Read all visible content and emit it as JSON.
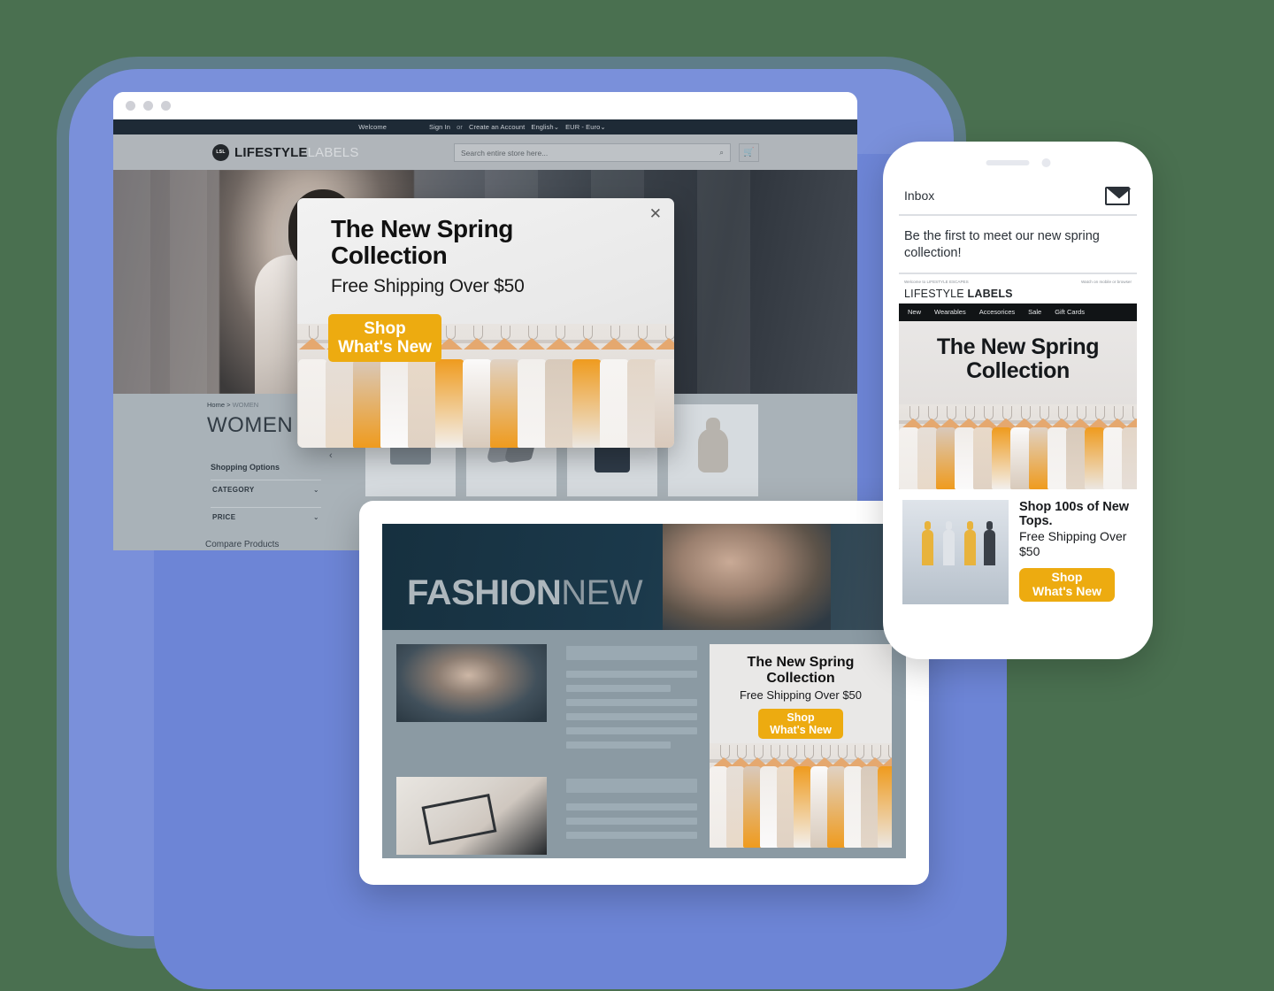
{
  "theme": {
    "background": "#4a7050",
    "frame_blue": "#6d85d6",
    "accent_yellow": "#edab10",
    "dark_navy": "#1e2a36"
  },
  "browser": {
    "window_dots": 3,
    "topbar": {
      "welcome": "Welcome",
      "sign_in": "Sign In",
      "or": "or",
      "create_account": "Create an Account",
      "language": "English",
      "currency": "EUR - Euro",
      "chevron": "⌄"
    },
    "header": {
      "logo_badge": "LSL",
      "logo_bold": "LIFESTYLE",
      "logo_light": "LABELS",
      "search_placeholder": "Search entire store here...",
      "search_icon": "⌕",
      "cart_icon": "🛒"
    },
    "category": {
      "breadcrumb_home": "Home",
      "breadcrumb_sep": ">",
      "breadcrumb_current": "WOMEN",
      "title": "WOMEN",
      "shopping_options": "Shopping Options",
      "filters": [
        {
          "label": "CATEGORY",
          "chevron": "⌄"
        },
        {
          "label": "PRICE",
          "chevron": "⌄"
        }
      ],
      "compare": "Compare Products",
      "carousel_prev": "‹",
      "tiles": [
        "handbag-thumbnail",
        "heels-thumbnail",
        "dress-thumbnail",
        "necklace-bust-thumbnail"
      ]
    },
    "popup": {
      "close": "✕",
      "title": "The New Spring Collection",
      "subtitle": "Free Shipping Over $50",
      "cta_line1": "Shop",
      "cta_line2": "What's New"
    }
  },
  "phone": {
    "inbox_label": "Inbox",
    "envelope_icon": "envelope-icon",
    "preheader": "Be the first to meet our new spring collection!",
    "email": {
      "preheader_left": "Welcome to LIFESTYLE ESCAPES",
      "preheader_right": "Watch on mobile or browser",
      "logo_light": "LIFESTYLE",
      "logo_bold": "LABELS",
      "nav": [
        "New",
        "Wearables",
        "Accesorices",
        "Sale",
        "Gift Cards"
      ],
      "hero_title": "The New Spring Collection",
      "promo_title": "Shop 100s of New Tops.",
      "promo_subtitle": "Free Shipping Over $50",
      "cta_line1": "Shop",
      "cta_line2": "What's New"
    }
  },
  "tablet": {
    "hero_bold": "FASHION",
    "hero_light": "NEW",
    "articles": [
      {
        "image": "woman-portrait-photo",
        "lines": 6
      },
      {
        "image": "black-friday-70-percent-off-photo",
        "lines": 4
      }
    ],
    "card": {
      "title": "The New Spring Collection",
      "subtitle": "Free Shipping Over $50",
      "cta_line1": "Shop",
      "cta_line2": "What's New"
    }
  }
}
